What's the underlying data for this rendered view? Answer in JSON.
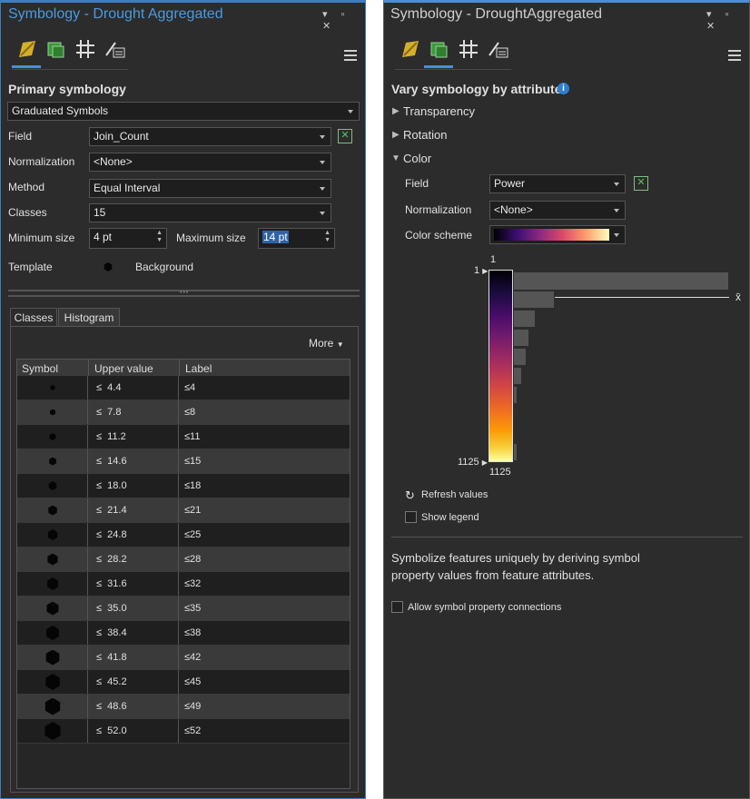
{
  "left_panel": {
    "title": "Symbology - Drought Aggregated",
    "heading": "Primary symbology",
    "symbology_type": "Graduated Symbols",
    "field_label": "Field",
    "field_value": "Join_Count",
    "normalization_label": "Normalization",
    "normalization_value": "<None>",
    "method_label": "Method",
    "method_value": "Equal Interval",
    "classes_label": "Classes",
    "classes_value": "15",
    "min_size_label": "Minimum size",
    "min_size_value": "4 pt",
    "max_size_label": "Maximum size",
    "max_size_value": "14 pt",
    "template_label": "Template",
    "background_label": "Background",
    "tabs": [
      "Classes",
      "Histogram"
    ],
    "more_label": "More",
    "columns": [
      "Symbol",
      "Upper value",
      "Label"
    ],
    "rows": [
      {
        "upper": "≤  4.4",
        "label": "≤4"
      },
      {
        "upper": "≤  7.8",
        "label": "≤8"
      },
      {
        "upper": "≤  11.2",
        "label": "≤11"
      },
      {
        "upper": "≤  14.6",
        "label": "≤15"
      },
      {
        "upper": "≤  18.0",
        "label": "≤18"
      },
      {
        "upper": "≤  21.4",
        "label": "≤21"
      },
      {
        "upper": "≤  24.8",
        "label": "≤25"
      },
      {
        "upper": "≤  28.2",
        "label": "≤28"
      },
      {
        "upper": "≤  31.6",
        "label": "≤32"
      },
      {
        "upper": "≤  35.0",
        "label": "≤35"
      },
      {
        "upper": "≤  38.4",
        "label": "≤38"
      },
      {
        "upper": "≤  41.8",
        "label": "≤42"
      },
      {
        "upper": "≤  45.2",
        "label": "≤45"
      },
      {
        "upper": "≤  48.6",
        "label": "≤49"
      },
      {
        "upper": "≤  52.0",
        "label": "≤52"
      }
    ]
  },
  "right_panel": {
    "title": "Symbology - DroughtAggregated",
    "heading": "Vary symbology by attribute",
    "info_icon": "i",
    "sections": [
      "Transparency",
      "Rotation",
      "Color"
    ],
    "field_label": "Field",
    "field_value": "Power",
    "normalization_label": "Normalization",
    "normalization_value": "<None>",
    "color_scheme_label": "Color scheme",
    "ramp_top_value": "1",
    "ramp_top_marker": "1",
    "ramp_bottom_marker": "1125",
    "ramp_bottom_value": "1125",
    "mean_label": "x̄",
    "refresh_label": "Refresh values",
    "show_legend_label": "Show legend",
    "description": "Symbolize features uniquely by deriving symbol property values from feature attributes.",
    "allow_connections_label": "Allow symbol property connections"
  },
  "colors": {
    "accent": "#4a8fd6",
    "panel_bg": "#2c2c2c",
    "excel_green": "#5fbf5f"
  }
}
